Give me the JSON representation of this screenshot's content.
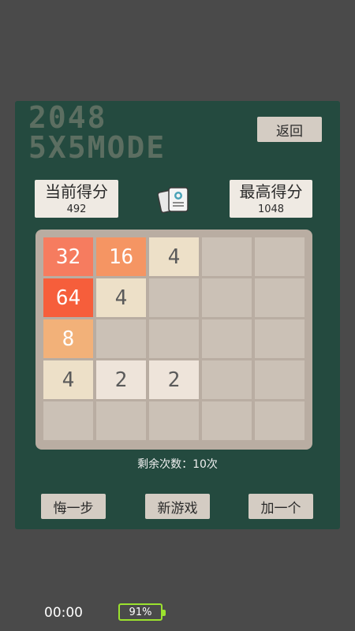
{
  "title": {
    "line1": "2048",
    "line2": "5X5MODE"
  },
  "back_button": "返回",
  "current_score": {
    "label": "当前得分",
    "value": "492"
  },
  "best_score": {
    "label": "最高得分",
    "value": "1048"
  },
  "board": {
    "rows": 5,
    "cols": 5,
    "tiles": [
      [
        "32",
        "16",
        "4",
        "",
        ""
      ],
      [
        "64",
        "4",
        "",
        "",
        ""
      ],
      [
        "8",
        "",
        "",
        "",
        ""
      ],
      [
        "4",
        "2",
        "2",
        "",
        ""
      ],
      [
        "",
        "",
        "",
        "",
        ""
      ]
    ]
  },
  "tile_colors": {
    "2": {
      "bg": "#eee4da",
      "fg": "#5a5a5a"
    },
    "4": {
      "bg": "#ede0c8",
      "fg": "#5a5a5a"
    },
    "8": {
      "bg": "#f2b179",
      "fg": "#ffffff"
    },
    "16": {
      "bg": "#f59563",
      "fg": "#ffffff"
    },
    "32": {
      "bg": "#f67c5f",
      "fg": "#ffffff"
    },
    "64": {
      "bg": "#f65e3b",
      "fg": "#ffffff"
    }
  },
  "remaining_text": "剩余次数：10次",
  "buttons": {
    "undo": "悔一步",
    "new_game": "新游戏",
    "add_one": "加一个"
  },
  "status": {
    "time": "00:00",
    "battery": "91%"
  },
  "colors": {
    "panel": "#244a3f",
    "board": "#b9ada2",
    "empty_cell": "#cbc1b6",
    "battery": "#9be22e"
  }
}
